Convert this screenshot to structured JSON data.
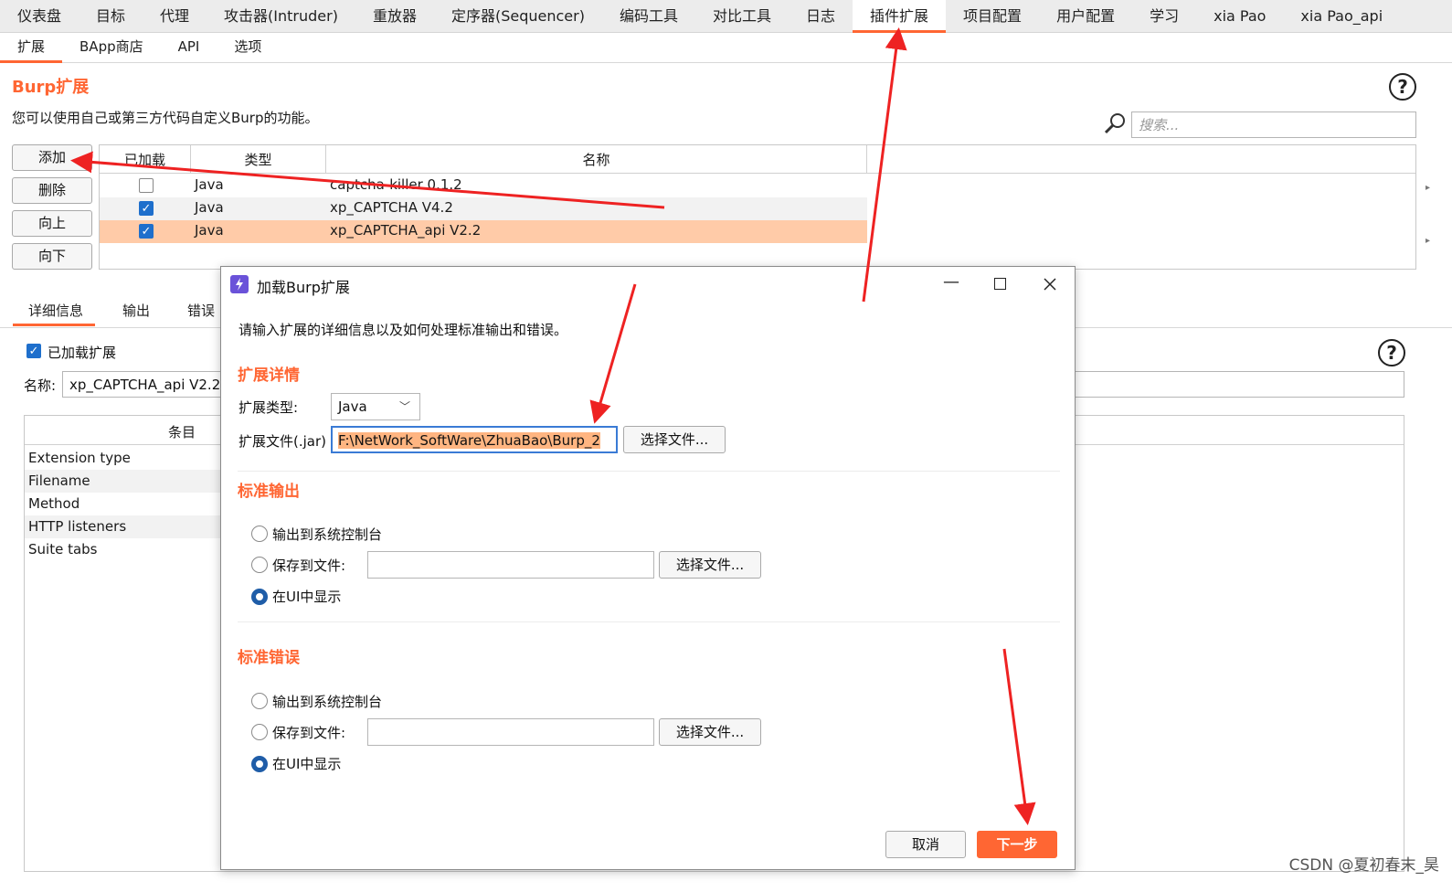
{
  "top_tabs": [
    "仪表盘",
    "目标",
    "代理",
    "攻击器(Intruder)",
    "重放器",
    "定序器(Sequencer)",
    "编码工具",
    "对比工具",
    "日志",
    "插件扩展",
    "项目配置",
    "用户配置",
    "学习",
    "xia Pao",
    "xia Pao_api"
  ],
  "active_top_tab": "插件扩展",
  "sub_tabs": [
    "扩展",
    "BApp商店",
    "API",
    "选项"
  ],
  "active_sub_tab": "扩展",
  "extensions": {
    "title": "Burp扩展",
    "description": "您可以使用自己或第三方代码自定义Burp的功能。",
    "search_placeholder": "搜索...",
    "buttons": {
      "add": "添加",
      "remove": "删除",
      "up": "向上",
      "down": "向下"
    },
    "table": {
      "headers": {
        "loaded": "已加载",
        "type": "类型",
        "name": "名称"
      },
      "rows": [
        {
          "loaded": false,
          "type": "Java",
          "name": "captcha-killer 0.1.2"
        },
        {
          "loaded": true,
          "type": "Java",
          "name": "xp_CAPTCHA V4.2"
        },
        {
          "loaded": true,
          "type": "Java",
          "name": "xp_CAPTCHA_api V2.2",
          "selected": true
        }
      ]
    }
  },
  "details": {
    "tabs": [
      "详细信息",
      "输出",
      "错误"
    ],
    "loaded_label": "已加载扩展",
    "name_label": "名称:",
    "name_value": "xp_CAPTCHA_api V2.2",
    "items_header": "条目",
    "items": [
      "Extension type",
      "Filename",
      "Method",
      "HTTP listeners",
      "Suite tabs"
    ]
  },
  "dialog": {
    "title": "加载Burp扩展",
    "intro": "请输入扩展的详细信息以及如何处理标准输出和错误。",
    "section_details": "扩展详情",
    "type_label": "扩展类型:",
    "type_value": "Java",
    "file_label": "扩展文件(.jar)",
    "file_value": "F:\\NetWork_SoftWare\\ZhuaBao\\Burp_2",
    "choose_file": "选择文件...",
    "section_stdout": "标准输出",
    "section_stderr": "标准错误",
    "opt_console": "输出到系统控制台",
    "opt_file": "保存到文件:",
    "opt_ui": "在UI中显示",
    "cancel": "取消",
    "next": "下一步"
  },
  "colors": {
    "accent": "#ff6633",
    "selection": "#ffcba8",
    "annotation_arrow": "#ee2222"
  },
  "watermark": "CSDN @夏初春末_昊"
}
